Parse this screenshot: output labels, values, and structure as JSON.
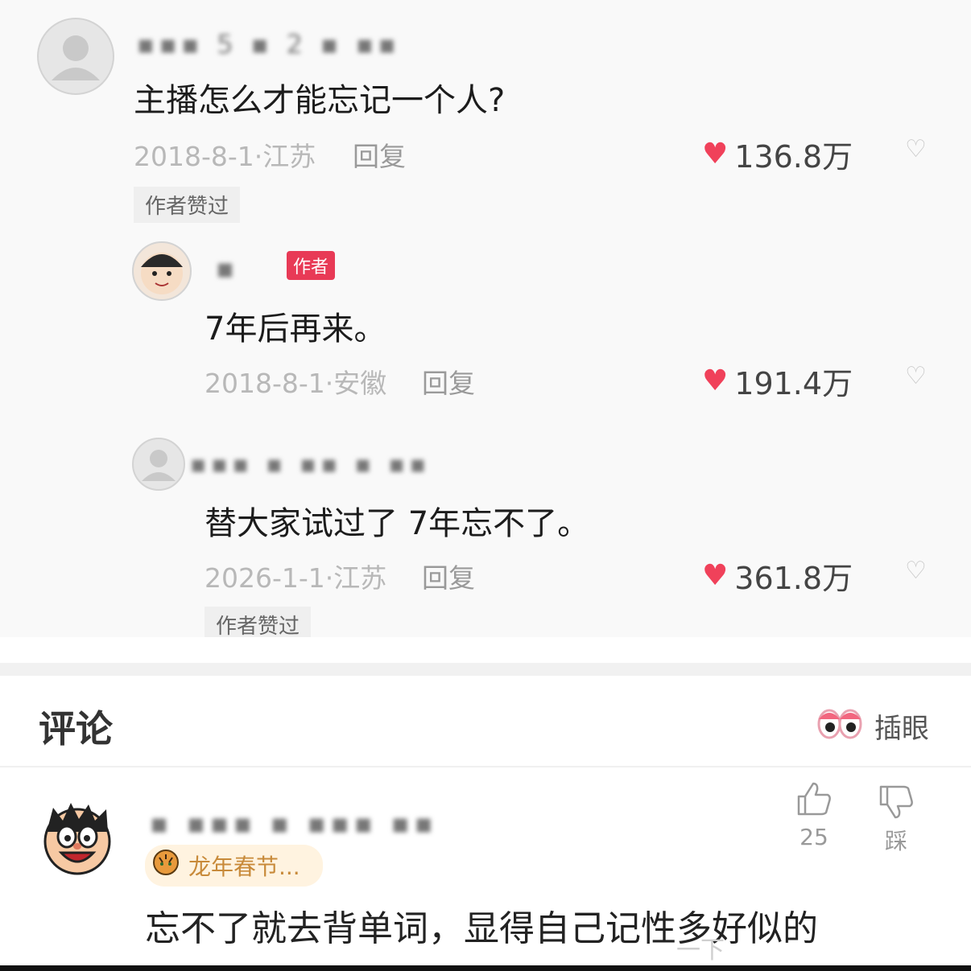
{
  "comment1": {
    "username": "▪▪▪ 5 ▪ 2 ▪ ▪▪",
    "text": "主播怎么才能忘记一个人?",
    "meta": "2018-8-1·江苏",
    "reply_label": "回复",
    "likes": "136.8万",
    "badge": "作者赞过"
  },
  "comment2": {
    "username": "▪",
    "author_tag": "作者",
    "text": "7年后再来。",
    "meta": "2018-8-1·安徽",
    "reply_label": "回复",
    "likes": "191.4万"
  },
  "comment3": {
    "username": "▪▪▪ ▪ ▪▪ ▪ ▪▪",
    "text": "替大家试过了 7年忘不了。",
    "meta": "2026-1-1·江苏",
    "reply_label": "回复",
    "likes": "361.8万",
    "badge": "作者赞过"
  },
  "comments_section": {
    "title": "评论",
    "insert_eye_label": "插眼"
  },
  "bottom_comment": {
    "username": "▪ ▪▪▪ ▪ ▪▪▪ ▪▪",
    "medal": "龙年春节...",
    "text": "忘不了就去背单词，显得自己记性多好似的",
    "like_count": "25",
    "dislike_label": "踩"
  },
  "watermark": "一下",
  "colors": {
    "heart": "#f0415a",
    "author_tag": "#e83a56",
    "medal_text": "#c88a3a"
  }
}
